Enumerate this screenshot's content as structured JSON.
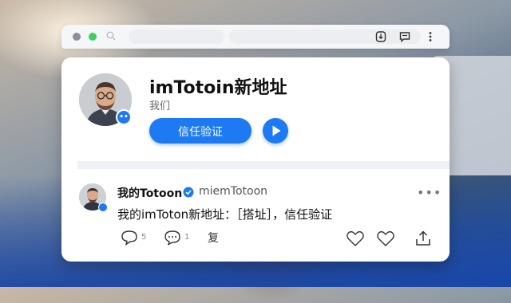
{
  "colors": {
    "accent": "#1d7af3",
    "background": "#ffffff"
  },
  "browser": {
    "icons": [
      "search-icon",
      "download-icon",
      "chat-icon",
      "more-vertical-icon"
    ]
  },
  "profile": {
    "name": "imTotoin新地址",
    "subtitle": "我们",
    "primary_button": "信任验证",
    "play_icon": "play-icon"
  },
  "post": {
    "author": "我的Totoon",
    "handle": "miemTotoon",
    "more": "•••",
    "text": "我的imToton新地址：［搭址］，信任验证",
    "actions": {
      "reply_count": "5",
      "comment_count": "1",
      "share_label": "复"
    }
  }
}
